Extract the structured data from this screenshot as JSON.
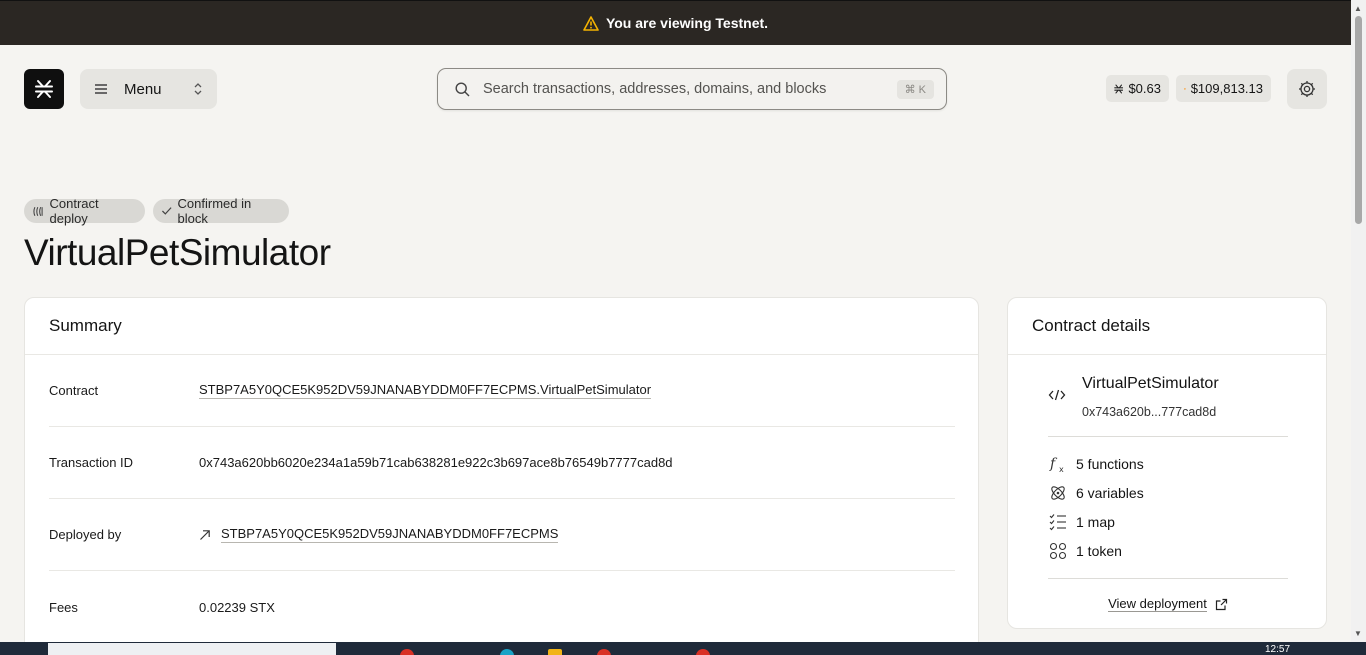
{
  "banner": {
    "text": "You are viewing Testnet."
  },
  "header": {
    "menu_label": "Menu",
    "search_placeholder": "Search transactions, addresses, domains, and blocks",
    "search_shortcut": "⌘ K",
    "stx_price": "$0.63",
    "btc_price": "$109,813.13"
  },
  "badges": {
    "deploy": "Contract deploy",
    "confirmed": "Confirmed in block"
  },
  "page_title": "VirtualPetSimulator",
  "summary": {
    "heading": "Summary",
    "rows": [
      {
        "label": "Contract",
        "value": "STBP7A5Y0QCE5K952DV59JNANABYDDM0FF7ECPMS.VirtualPetSimulator"
      },
      {
        "label": "Transaction ID",
        "value": "0x743a620bb6020e234a1a59b71cab638281e922c3b697ace8b76549b7777cad8d"
      },
      {
        "label": "Deployed by",
        "value": "STBP7A5Y0QCE5K952DV59JNANABYDDM0FF7ECPMS"
      },
      {
        "label": "Fees",
        "value": "0.02239 STX"
      }
    ]
  },
  "details": {
    "heading": "Contract details",
    "contract_name": "VirtualPetSimulator",
    "contract_hash": "0x743a620b...777cad8d",
    "stats": {
      "functions": "5 functions",
      "variables": "6 variables",
      "maps": "1 map",
      "tokens": "1 token"
    },
    "view_deployment": "View deployment"
  },
  "taskbar": {
    "clock": "12:57"
  }
}
